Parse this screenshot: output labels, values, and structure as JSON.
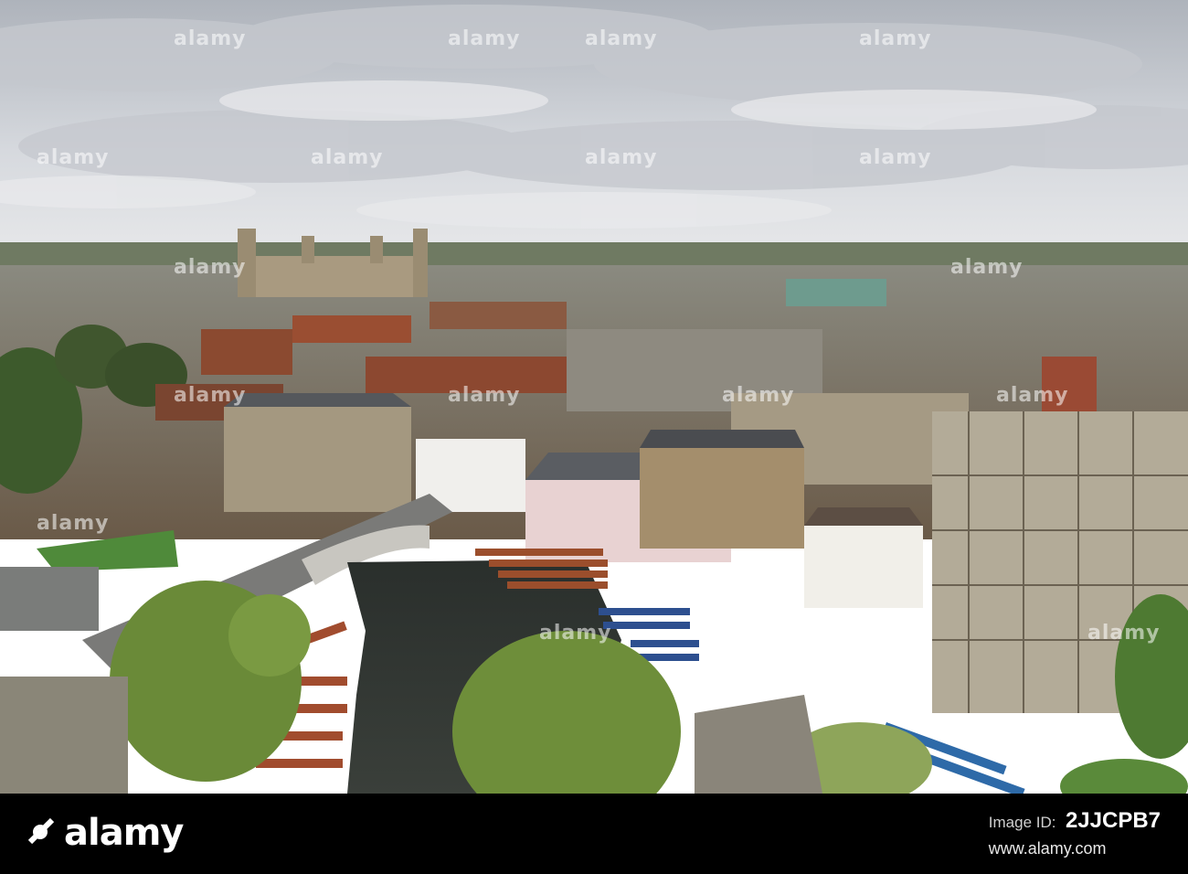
{
  "photo": {
    "subject": "aerial-cityscape-river-punts"
  },
  "watermark": {
    "text": "alamy"
  },
  "footer": {
    "logo_text": "alamy",
    "id_label": "Image ID:",
    "id_value": "2JJCPB7",
    "site": "www.alamy.com"
  }
}
